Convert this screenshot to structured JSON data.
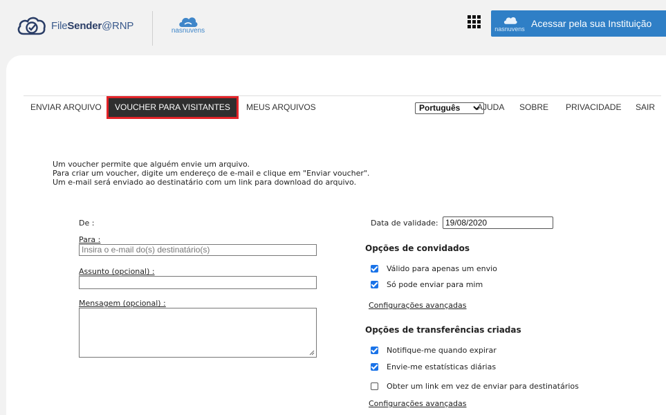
{
  "header": {
    "brand_prefix": "File",
    "brand_bold": "Sender",
    "brand_suffix": "@RNP",
    "partner_logo_text": "nasnuvens",
    "login_button_logo_text": "nasnuvens",
    "login_button_label": "Acessar pela sua Instituição"
  },
  "nav": {
    "items": [
      "ENVIAR ARQUIVO",
      "VOUCHER PARA VISITANTES",
      "MEUS ARQUIVOS"
    ],
    "language": "Português",
    "right_items": [
      "AJUDA",
      "SOBRE",
      "PRIVACIDADE",
      "SAIR"
    ]
  },
  "intro": [
    "Um voucher permite que alguém envie um arquivo.",
    "Para criar um voucher, digite um endereço de e-mail e clique em \"Enviar voucher\".",
    "Um e-mail será enviado ao destinatário com um link para download do arquivo."
  ],
  "form": {
    "from_label": "De :",
    "to_label": "Para :",
    "to_placeholder": "Insira o e-mail do(s) destinatário(s)",
    "subject_label": "Assunto (opcional) :",
    "message_label": "Mensagem (opcional) :"
  },
  "options": {
    "expiry_label": "Data de validade:",
    "expiry_value": "19/08/2020",
    "guest_heading": "Opções de convidados",
    "guest_options": [
      {
        "label": "Válido para apenas um envio",
        "checked": true
      },
      {
        "label": "Só pode enviar para mim",
        "checked": true
      }
    ],
    "guest_advanced": "Configurações avançadas",
    "transfer_heading": "Opções de transferências criadas",
    "transfer_options": [
      {
        "label": "Notifique-me quando expirar",
        "checked": true
      },
      {
        "label": "Envie-me estatísticas diárias",
        "checked": true
      },
      {
        "label": "Obter um link em vez de enviar para destinatários",
        "checked": false
      }
    ],
    "transfer_advanced": "Configurações avançadas"
  },
  "colors": {
    "accent_blue": "#2f7fc6",
    "checkbox_blue": "#1a73e8",
    "active_tab_bg": "#2f2f2f",
    "active_tab_border": "#e32328"
  }
}
